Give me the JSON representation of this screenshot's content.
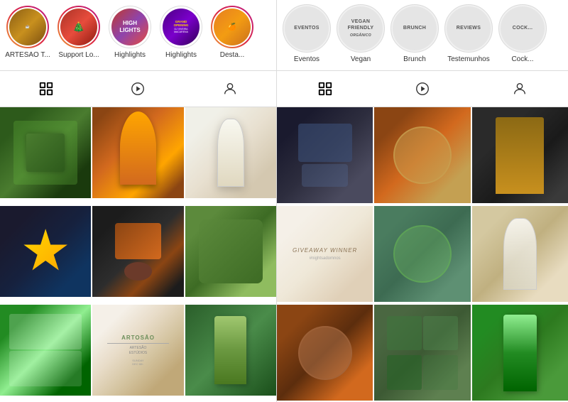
{
  "left": {
    "stories": [
      {
        "id": "artesao",
        "label": "ARTESÃO T...",
        "avatar_class": "left-avatar-1",
        "border": "gradient"
      },
      {
        "id": "support",
        "label": "Support Lo...",
        "avatar_class": "left-avatar-2",
        "border": "gradient"
      },
      {
        "id": "highlights1",
        "label": "Highlights",
        "avatar_class": "left-avatar-3",
        "border": "plain",
        "text": "Highlights"
      },
      {
        "id": "highlights2",
        "label": "Highlights",
        "avatar_class": "left-avatar-4",
        "border": "plain",
        "text": "GRAND\nOPENING"
      },
      {
        "id": "desta",
        "label": "Desta...",
        "avatar_class": "left-avatar-5",
        "border": "gradient"
      }
    ],
    "tabs": [
      "grid",
      "reels",
      "tagged"
    ],
    "grid_colors": [
      "lc1",
      "lc2",
      "lc3",
      "lc4",
      "lc5",
      "lc6",
      "lc7",
      "lc8",
      "lc9"
    ]
  },
  "right": {
    "stories": [
      {
        "id": "eventos",
        "label": "Eventos",
        "text": "EVENTOS"
      },
      {
        "id": "vegan",
        "label": "Vegan",
        "text": "VEGAN FRIENDLY\norgânico"
      },
      {
        "id": "brunch",
        "label": "Brunch",
        "text": "BRUNCH"
      },
      {
        "id": "testemunhos",
        "label": "Testemunhos",
        "text": "REVIEWS"
      },
      {
        "id": "cock",
        "label": "Cock...",
        "text": "COCK..."
      }
    ],
    "tabs": [
      "grid",
      "reels",
      "tagged"
    ],
    "grid_colors": [
      "rc1",
      "rc2",
      "rc3",
      "rc4",
      "rc5",
      "rc6",
      "rc7",
      "rc8",
      "rc9"
    ],
    "giveaway_text": "GIVEAWAY WINNER",
    "giveaway_sub": "#nightsadomnos"
  }
}
